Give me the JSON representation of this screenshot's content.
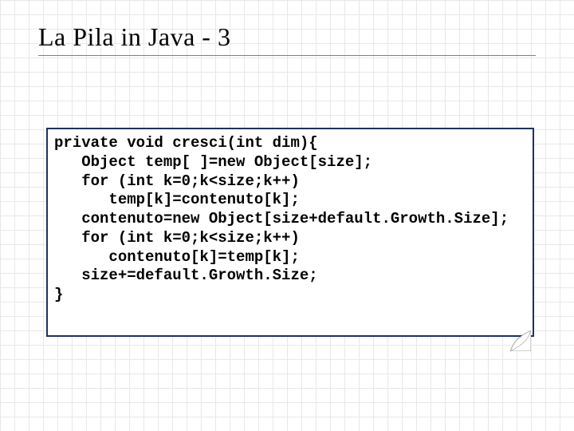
{
  "title": "La Pila in Java - 3",
  "code": {
    "l1": "private void cresci(int dim){",
    "l2": "   Object temp[ ]=new Object[size];",
    "l3": "   for (int k=0;k<size;k++)",
    "l4": "      temp[k]=contenuto[k];",
    "l5": "   contenuto=new Object[size+default.Growth.Size];",
    "l6": "   for (int k=0;k<size;k++)",
    "l7": "      contenuto[k]=temp[k];",
    "l8": "   size+=default.Growth.Size;",
    "l9": "}"
  }
}
